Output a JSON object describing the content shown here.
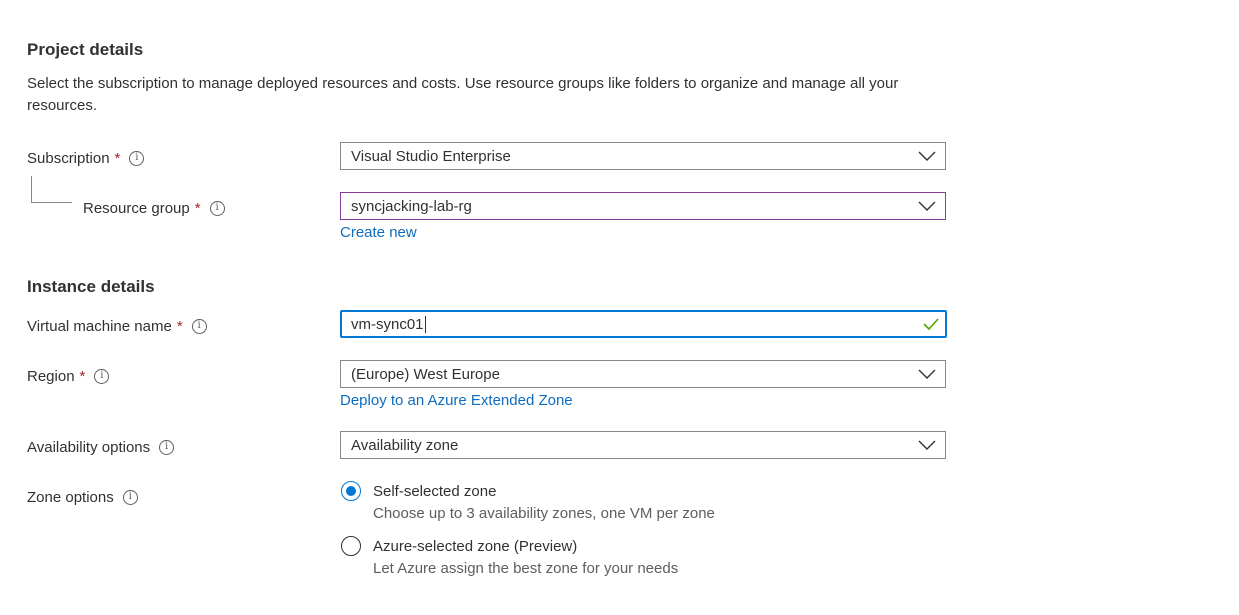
{
  "project": {
    "title": "Project details",
    "description": "Select the subscription to manage deployed resources and costs. Use resource groups like folders to organize and manage all your resources."
  },
  "subscription": {
    "label": "Subscription",
    "required": "*",
    "value": "Visual Studio Enterprise"
  },
  "resource_group": {
    "label": "Resource group",
    "required": "*",
    "value": "syncjacking-lab-rg",
    "create_link": "Create new"
  },
  "instance": {
    "title": "Instance details"
  },
  "vm_name": {
    "label": "Virtual machine name",
    "required": "*",
    "value": "vm-sync01",
    "valid": true
  },
  "region": {
    "label": "Region",
    "required": "*",
    "value": "(Europe) West Europe",
    "link": "Deploy to an Azure Extended Zone"
  },
  "availability": {
    "label": "Availability options",
    "value": "Availability zone"
  },
  "zone_options": {
    "label": "Zone options",
    "options": [
      {
        "label": "Self-selected zone",
        "sub": "Choose up to 3 availability zones, one VM per zone",
        "selected": true
      },
      {
        "label": "Azure-selected zone (Preview)",
        "sub": "Let Azure assign the best zone for your needs",
        "selected": false
      }
    ]
  },
  "info_glyph": "i",
  "colors": {
    "accent": "#0078d4",
    "link": "#0f6cbd",
    "required": "#a4262c",
    "focus_border": "#8a3c9e",
    "valid": "#57a300"
  },
  "icons": {
    "info": "info-icon",
    "dropdown": "chevron-down-icon",
    "valid": "checkmark-icon"
  }
}
